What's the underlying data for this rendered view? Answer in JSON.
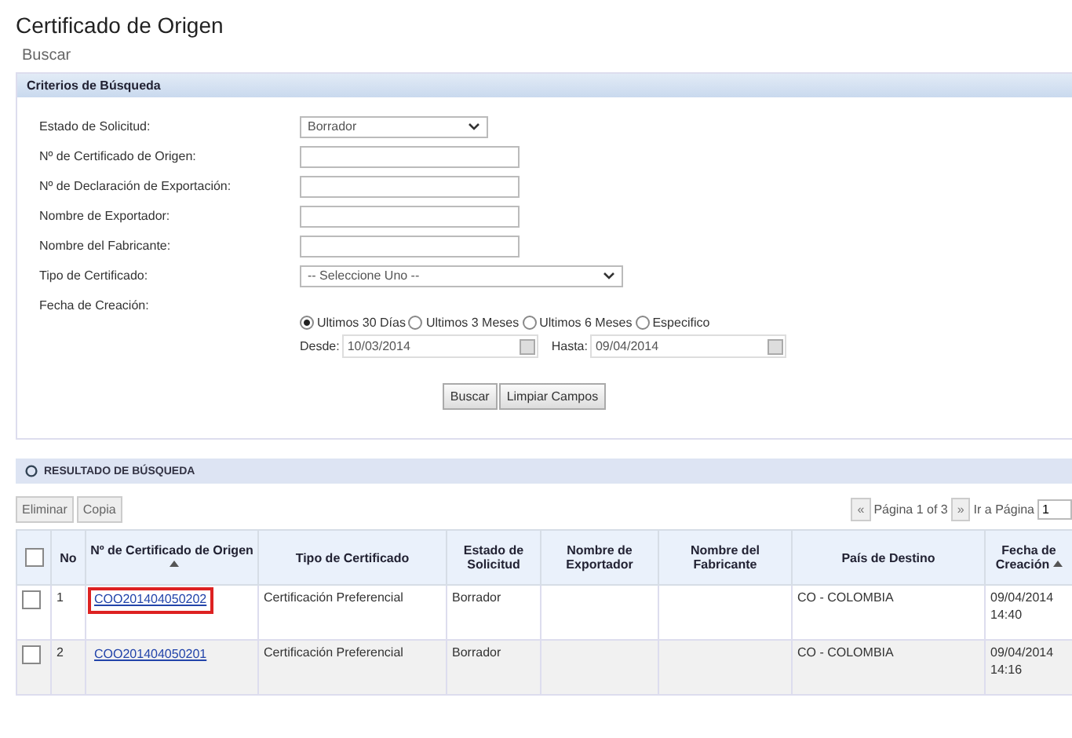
{
  "page": {
    "title": "Certificado de Origen",
    "breadcrumb": "Buscar"
  },
  "criteria": {
    "title": "Criterios de Búsqueda",
    "fields": [
      {
        "kind": "select",
        "label": "Estado de Solicitud:",
        "value": "Borrador"
      },
      {
        "kind": "text",
        "label": "Nº de Certificado de Origen:"
      },
      {
        "kind": "text",
        "label": "Nº de Declaración de Exportación:"
      },
      {
        "kind": "text",
        "label": "Nombre de Exportador:"
      },
      {
        "kind": "text",
        "label": "Nombre del Fabricante:"
      },
      {
        "kind": "wideselect",
        "label": "Tipo de Certificado:",
        "value": "-- Seleccione Uno --"
      },
      {
        "kind": "label",
        "label": "Fecha de Creación:"
      }
    ],
    "date_options": [
      {
        "label": "Ultimos 30 Días",
        "selected": true
      },
      {
        "label": "Ultimos 3 Meses",
        "selected": false
      },
      {
        "label": "Ultimos 6 Meses",
        "selected": false
      },
      {
        "label": "Especifico",
        "selected": false
      }
    ],
    "from_label": "Desde:",
    "from_value": "10/03/2014",
    "to_label": "Hasta:",
    "to_value": "09/04/2014",
    "buttons": [
      "Buscar",
      "Limpiar Campos"
    ]
  },
  "results": {
    "title": "RESULTADO DE BÚSQUEDA",
    "all_checked": false,
    "actions": [
      "Eliminar",
      "Copia"
    ],
    "pager": {
      "prev": "«",
      "text": "Página 1 of 3",
      "next": "»",
      "goto_label": "Ir a Página",
      "page": "1"
    },
    "columns": [
      {
        "label": "No",
        "sortable": false
      },
      {
        "label": "Nº de Certificado de Origen",
        "sortable": true
      },
      {
        "label": "Tipo de Certificado",
        "sortable": false
      },
      {
        "label": "Estado de Solicitud",
        "sortable": false
      },
      {
        "label": "Nombre de Exportador",
        "sortable": false
      },
      {
        "label": "Nombre del Fabricante",
        "sortable": false
      },
      {
        "label": "País de Destino",
        "sortable": false
      },
      {
        "label": "Fecha de Creación",
        "sortable": true
      }
    ],
    "rows": [
      {
        "checked": false,
        "highlighted": true,
        "no": "1",
        "certificate": "COO201404050202",
        "type": "Certificación Preferencial",
        "status": "Borrador",
        "country": "CO - COLOMBIA",
        "created": "09/04/2014 14:40"
      },
      {
        "checked": false,
        "highlighted": false,
        "no": "2",
        "certificate": "COO201404050201",
        "type": "Certificación Preferencial",
        "status": "Borrador",
        "country": "CO - COLOMBIA",
        "created": "09/04/2014 14:16"
      }
    ]
  }
}
